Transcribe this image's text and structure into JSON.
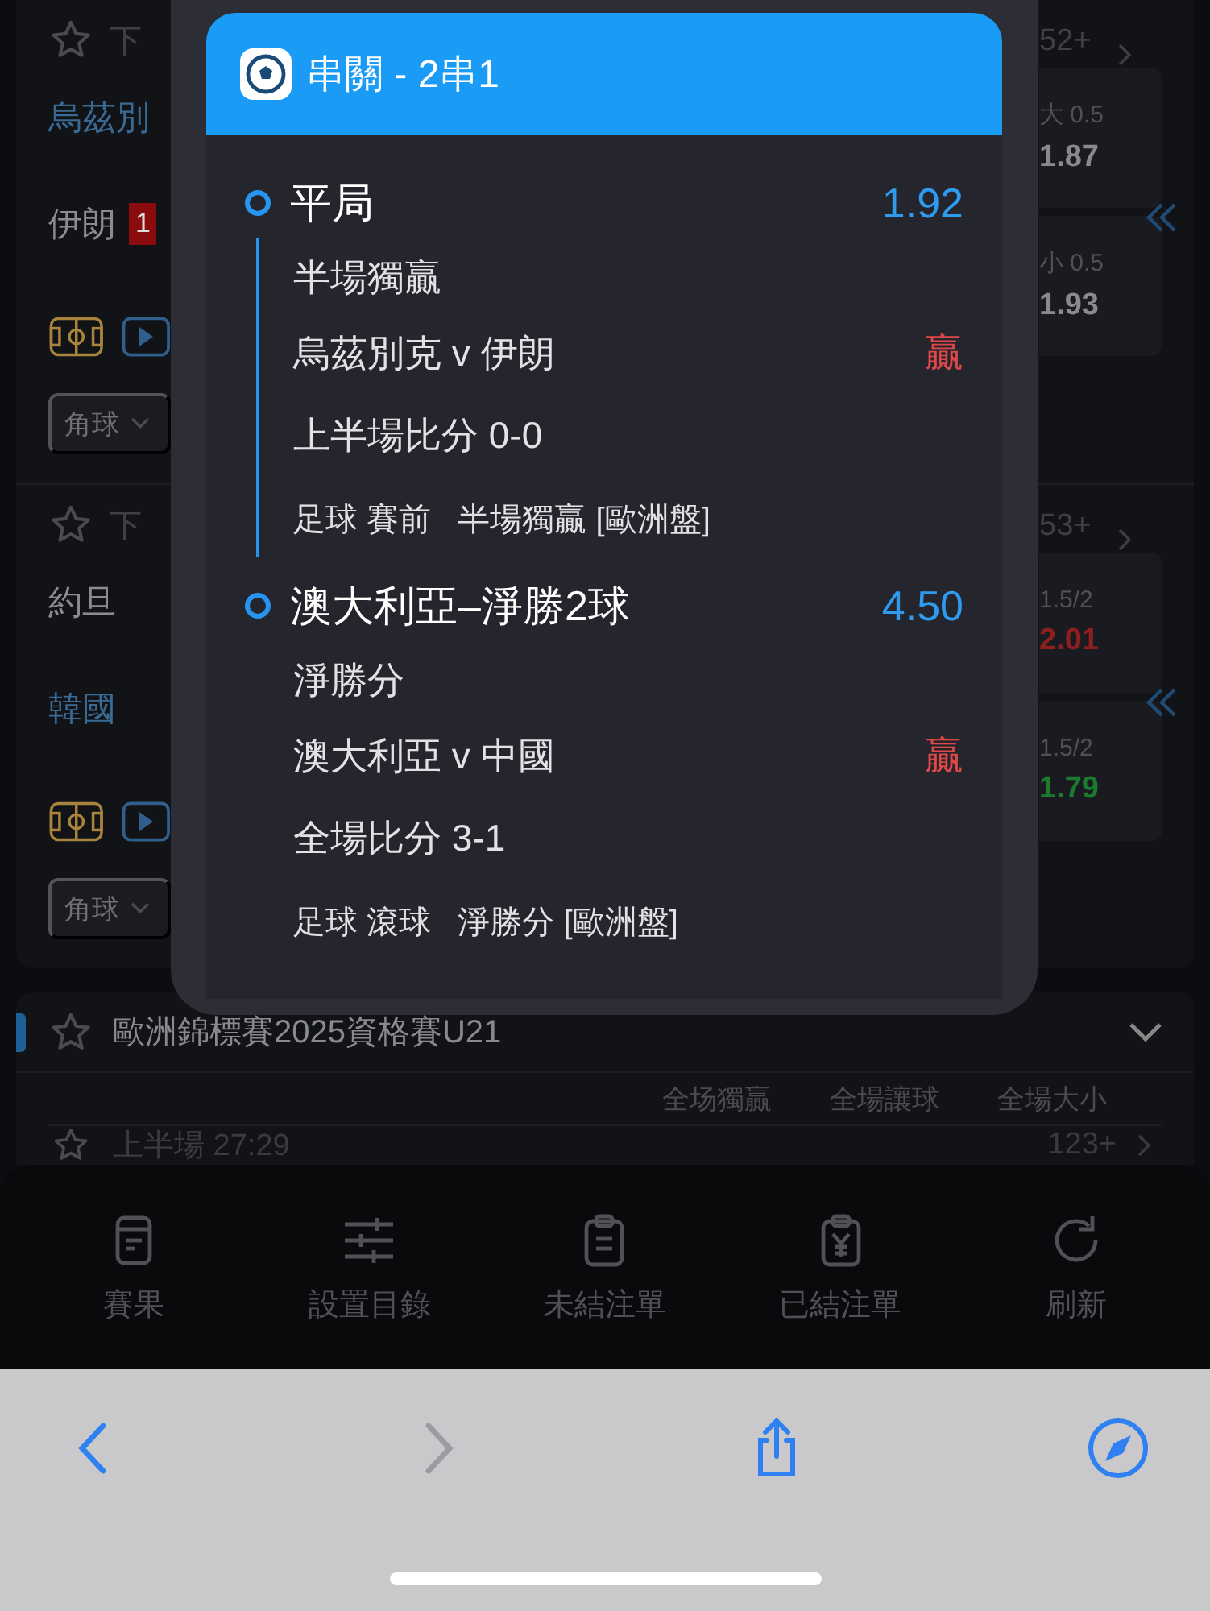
{
  "matches": [
    {
      "status": "下",
      "teams": [
        {
          "name": "烏茲別",
          "favorite": true
        },
        {
          "name": "伊朗",
          "favorite": false,
          "red_cards": "1"
        }
      ],
      "market": "角球",
      "count": "52+",
      "odds": [
        {
          "line": "大 0.5",
          "price": "1.87",
          "color": "#8a8a8e"
        },
        {
          "line": "小 0.5",
          "price": "1.93",
          "color": "#8a8a8e"
        }
      ]
    },
    {
      "status": "下",
      "teams": [
        {
          "name": "約旦",
          "favorite": false
        },
        {
          "name": "韓國",
          "favorite": true
        }
      ],
      "market": "角球",
      "count": "53+",
      "odds": [
        {
          "line": "1.5/2",
          "price": "2.01",
          "color": "#8e1f1f"
        },
        {
          "line": "1.5/2",
          "price": "1.79",
          "color": "#1c7a2d"
        }
      ]
    }
  ],
  "league": {
    "name": "歐洲錦標賽2025資格賽U21",
    "favorite": false,
    "expanded": true,
    "columns": [
      "全场獨贏",
      "全場讓球",
      "全場大小"
    ],
    "match": {
      "status": "上半場 27:29",
      "count": "123+"
    }
  },
  "popup": {
    "title": "串關 - 2串1",
    "legs": [
      {
        "selection": "平局",
        "odds": "1.92",
        "market": "半場獨贏",
        "fixture": "烏茲別克 v 伊朗",
        "result": "贏",
        "score": "上半場比分 0-0",
        "footer": "足球 賽前   半場獨贏 [歐洲盤]"
      },
      {
        "selection": "澳大利亞–淨勝2球",
        "odds": "4.50",
        "market": "淨勝分",
        "fixture": "澳大利亞 v 中國",
        "result": "贏",
        "score": "全場比分 3-1",
        "footer": "足球 滾球   淨勝分 [歐洲盤]"
      }
    ]
  },
  "toolbar": [
    {
      "label": "賽果"
    },
    {
      "label": "設置目錄"
    },
    {
      "label": "未結注單"
    },
    {
      "label": "已結注單"
    },
    {
      "label": "刷新"
    }
  ],
  "browser_bar": {
    "back": {
      "disabled": false
    },
    "forward": {
      "disabled": true
    }
  }
}
